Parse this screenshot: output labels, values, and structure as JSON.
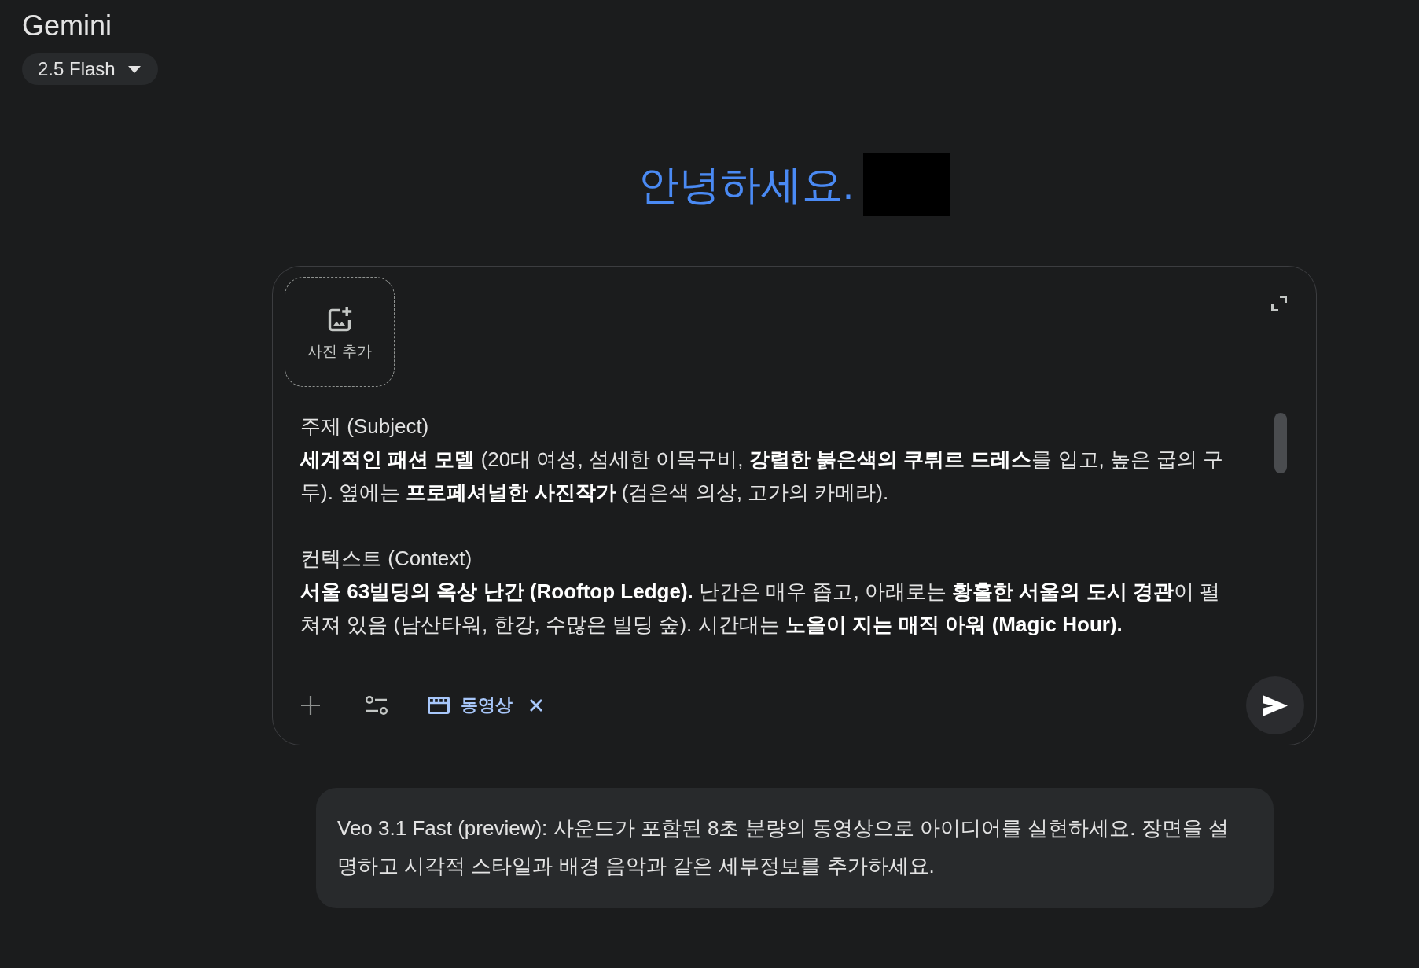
{
  "header": {
    "title": "Gemini",
    "model_picker": {
      "label": "2.5 Flash"
    }
  },
  "greeting": {
    "text": "안녕하세요.",
    "name_redacted": true
  },
  "prompt_box": {
    "attachment_tile": {
      "label": "사진 추가"
    },
    "sections": [
      {
        "heading": "주제 (Subject)",
        "body": "**세계적인 패션 모델** (20대 여성, 섬세한 이목구비, **강렬한 붉은색의 쿠튀르 드레스**를 입고, 높은 굽의 구두). 옆에는 **프로페셔널한 사진작가** (검은색 의상, 고가의 카메라)."
      },
      {
        "heading": "컨텍스트 (Context)",
        "body": "**서울 63빌딩의 옥상 난간 (Rooftop Ledge).** 난간은 매우 좁고, 아래로는 **황홀한 서울의 도시 경관**이 펼쳐져 있음 (남산타워, 한강, 수많은 빌딩 숲). 시간대는 **노을이 지는 매직 아워 (Magic Hour).**"
      }
    ],
    "mode_chip": {
      "label": "동영상",
      "removable": true
    }
  },
  "notice": {
    "text": "Veo 3.1 Fast (preview): 사운드가 포함된 8초 분량의 동영상으로 아이디어를 실현하세요. 장면을 설명하고 시각적 스타일과 배경 음악과 같은 세부정보를 추가하세요."
  }
}
